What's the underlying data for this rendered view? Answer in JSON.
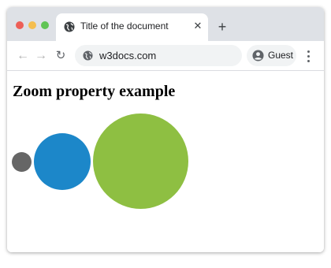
{
  "browser": {
    "tab": {
      "title": "Title of the document",
      "close_glyph": "✕",
      "favicon": "globe-icon"
    },
    "new_tab_glyph": "+",
    "nav": {
      "back_glyph": "←",
      "forward_glyph": "→",
      "reload_glyph": "↻"
    },
    "address": {
      "url": "w3docs.com",
      "icon": "globe-icon"
    },
    "profile": {
      "label": "Guest",
      "icon": "person-icon"
    },
    "menu_icon": "vertical-dots-icon"
  },
  "page": {
    "heading": "Zoom property example",
    "circles": [
      {
        "name": "small",
        "color": "#666666"
      },
      {
        "name": "medium",
        "color": "#1c87c9"
      },
      {
        "name": "large",
        "color": "#8ebf42"
      }
    ]
  },
  "colors": {
    "window_controls": [
      "#ed5f57",
      "#f5be4f",
      "#60c454"
    ],
    "tabstrip": "#dee1e6",
    "omnibox": "#f1f3f4"
  }
}
